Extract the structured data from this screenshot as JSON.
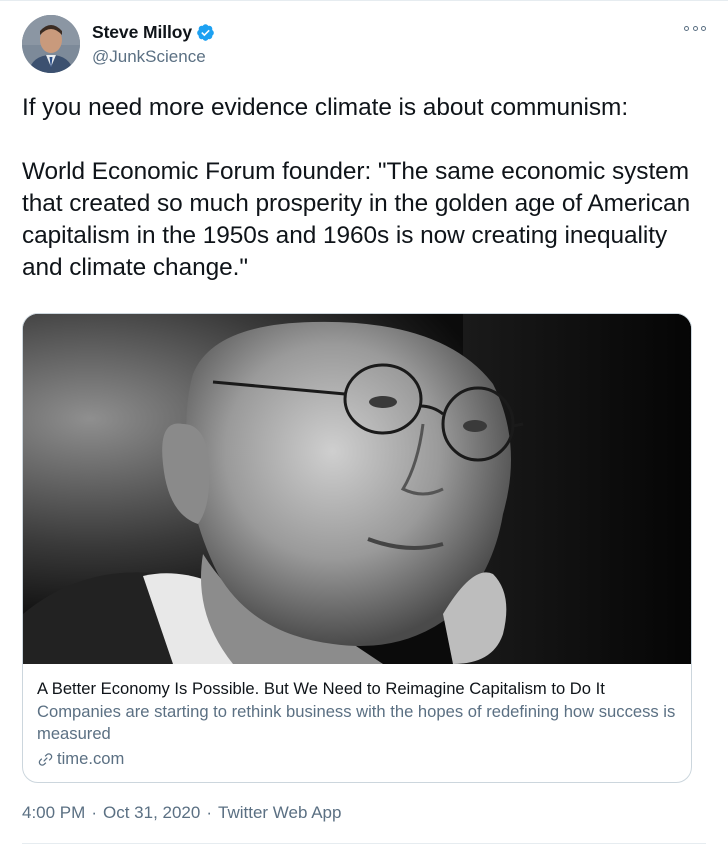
{
  "user": {
    "display_name": "Steve Milloy",
    "handle": "@JunkScience",
    "verified": true
  },
  "tweet": {
    "text": "If you need more evidence climate is about communism:\n\nWorld Economic Forum founder: \"The same economic system that created so much prosperity in the golden age of American capitalism in the 1950s and 1960s is now creating inequality and climate change.\""
  },
  "card": {
    "title": "A Better Economy Is Possible. But We Need to Reimagine Capitalism to Do It",
    "description": "Companies are starting to rethink business with the hopes of redefining how success is measured",
    "domain": "time.com"
  },
  "meta": {
    "time": "4:00 PM",
    "date": "Oct 31, 2020",
    "separator": "·",
    "source": "Twitter Web App"
  },
  "colors": {
    "verified_blue": "#1da1f2",
    "secondary_text": "#5b7083",
    "primary_text": "#0f1419",
    "border": "#ccd6dd"
  },
  "icons": {
    "verified": "verified-badge-icon",
    "more": "more-options-icon",
    "link": "link-icon"
  }
}
